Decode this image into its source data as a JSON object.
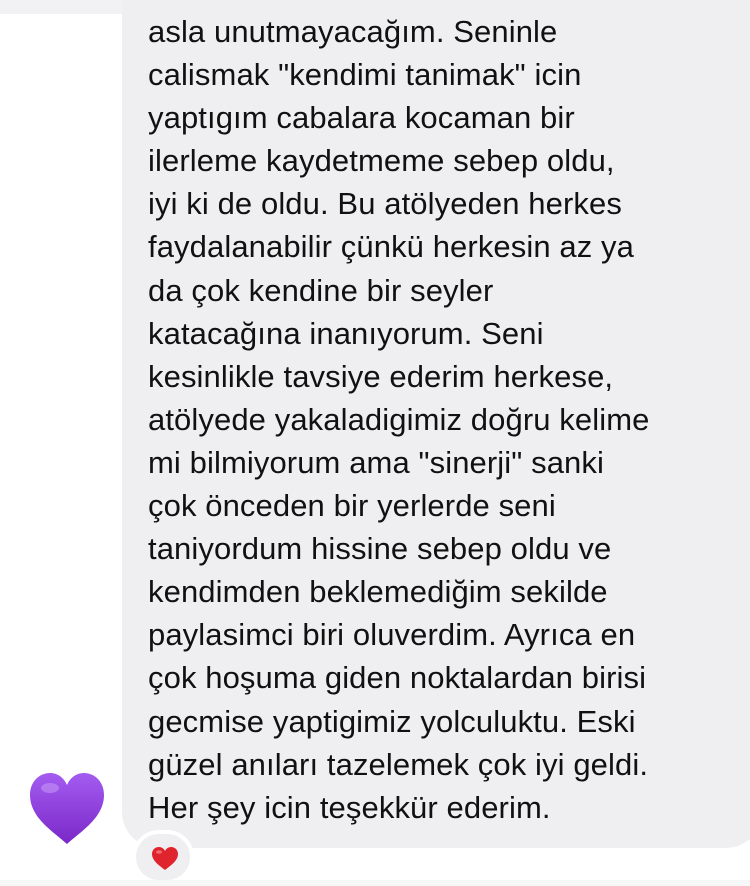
{
  "message": {
    "lines": [
      "asla unutmayacağım. Seninle",
      "calismak \"kendimi tanimak\" icin",
      "yaptıgım cabalara kocaman bir",
      "ilerleme kaydetmeme sebep oldu,",
      "iyi ki de oldu. Bu atölyeden herkes",
      "faydalanabilir çünkü herkesin az ya",
      "da çok kendine bir seyler",
      "katacağına inanıyorum. Seni",
      "kesinlikle tavsiye ederim herkese,",
      "atölyede yakaladigimiz doğru kelime",
      "mi bilmiyorum ama \"sinerji\" sanki",
      "çok önceden bir yerlerde seni",
      "taniyordum hissine sebep oldu ve",
      "kendimden beklemediğim sekilde",
      "paylasimci biri oluverdim. Ayrıca en",
      "çok hoşuma giden noktalardan birisi",
      "gecmise yaptigimiz yolculuktu. Eski",
      "güzel anıları tazelemek çok iyi geldi.",
      "Her şey icin teşekkür ederim."
    ]
  },
  "sender": {
    "avatar_icon": "purple-heart-icon",
    "avatar_color": "#8e3ad8"
  },
  "reaction": {
    "icon": "red-heart-icon",
    "color": "#e0242d"
  },
  "colors": {
    "bubble_background": "#efeff1",
    "text": "#111111",
    "page_background": "#ffffff"
  }
}
